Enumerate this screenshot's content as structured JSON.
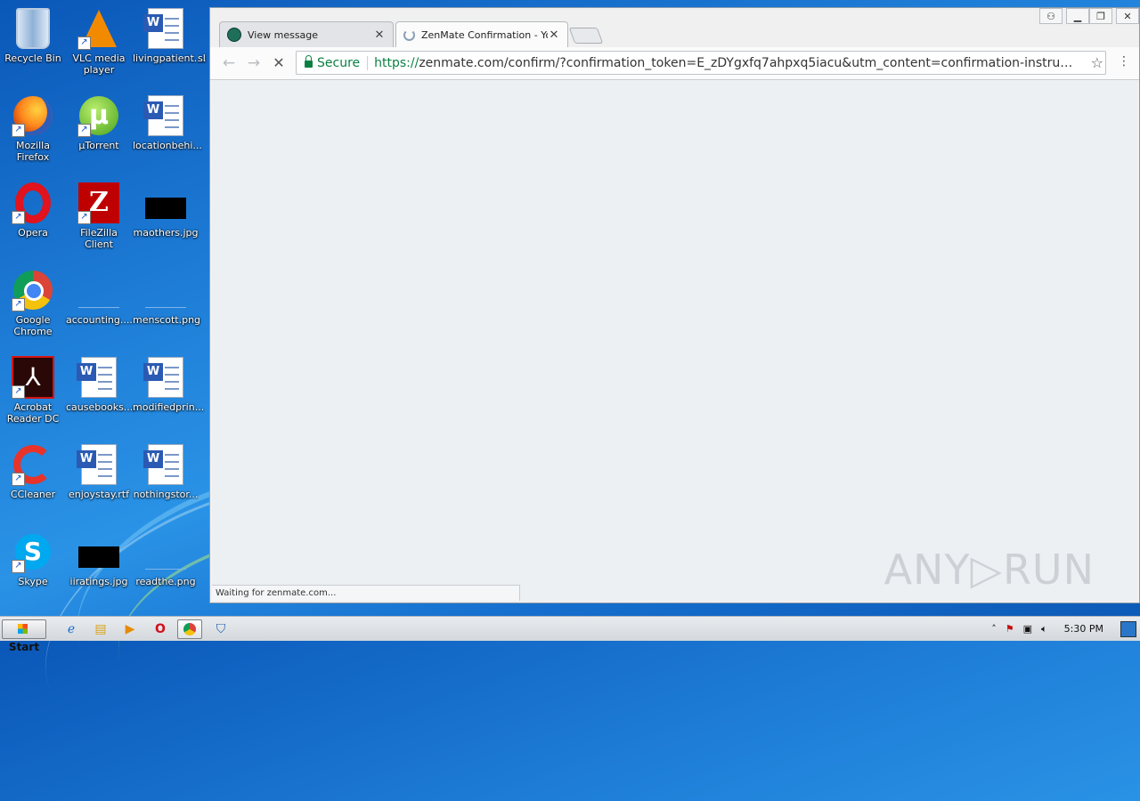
{
  "desktop": {
    "icons": [
      {
        "label": "Recycle Bin",
        "icon": "recycle-bin-icon"
      },
      {
        "label": "VLC media player",
        "icon": "vlc-icon"
      },
      {
        "label": "livingpatient....",
        "icon": "word-doc-icon"
      },
      {
        "label": "Mozilla Firefox",
        "icon": "firefox-icon"
      },
      {
        "label": "µTorrent",
        "icon": "utorrent-icon"
      },
      {
        "label": "locationbehi...",
        "icon": "word-doc-icon"
      },
      {
        "label": "Opera",
        "icon": "opera-icon"
      },
      {
        "label": "FileZilla Client",
        "icon": "filezilla-icon"
      },
      {
        "label": "maothers.jpg",
        "icon": "image-file-icon"
      },
      {
        "label": "Google Chrome",
        "icon": "chrome-icon"
      },
      {
        "label": "accounting....",
        "icon": "image-file-icon"
      },
      {
        "label": "menscott.png",
        "icon": "image-file-icon"
      },
      {
        "label": "Acrobat Reader DC",
        "icon": "acrobat-icon"
      },
      {
        "label": "causebooks....",
        "icon": "word-doc-icon"
      },
      {
        "label": "modifiedprin...",
        "icon": "word-doc-icon"
      },
      {
        "label": "CCleaner",
        "icon": "ccleaner-icon"
      },
      {
        "label": "enjoystay.rtf",
        "icon": "word-doc-icon"
      },
      {
        "label": "nothingstor...",
        "icon": "word-doc-icon"
      },
      {
        "label": "Skype",
        "icon": "skype-icon"
      },
      {
        "label": "iiratings.jpg",
        "icon": "image-file-icon"
      },
      {
        "label": "readthe.png",
        "icon": "image-file-icon"
      }
    ],
    "partial_label": "sl"
  },
  "browser": {
    "tabs": [
      {
        "title": "View message",
        "active": false,
        "favicon_color": "#1f6e5a"
      },
      {
        "title": "ZenMate Confirmation - You",
        "active": true,
        "loading": true
      }
    ],
    "toolbar": {
      "back": "←",
      "forward": "→",
      "stop": "✕",
      "secure_label": "Secure",
      "url_scheme": "https://",
      "url_host": "zenmate.com",
      "url_rest": "/confirm/?confirmation_token=E_zDYgxfq7ahpxq5iacu&utm_content=confirmation-instructions&utm_me...",
      "star": "☆",
      "menu": "⋮"
    },
    "status_text": "Waiting for zenmate.com...",
    "watermark": "ANY▷RUN"
  },
  "taskbar": {
    "start_label": "Start",
    "clock": "5:30 PM",
    "tray_arrow": "˄"
  },
  "colors": {
    "secure_green": "#0b8043",
    "desktop_blue": "#1f7fd8"
  }
}
